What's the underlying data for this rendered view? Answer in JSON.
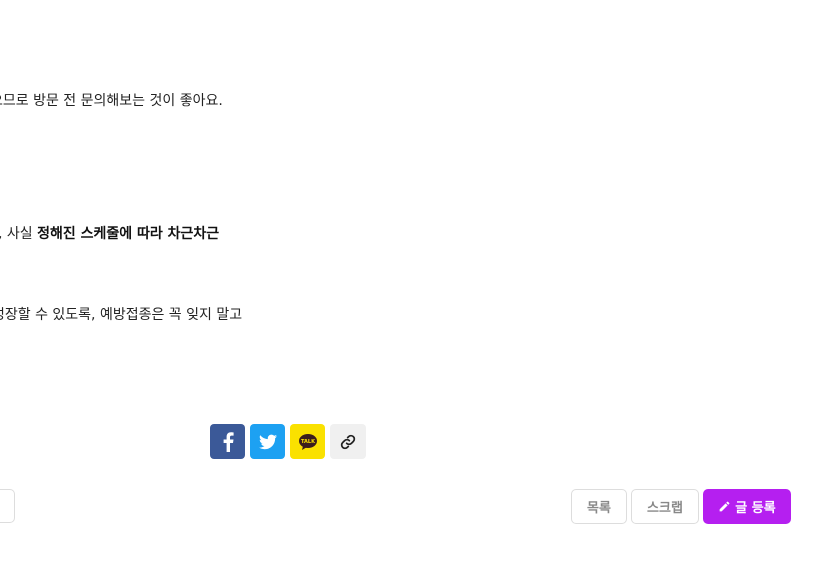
{
  "article": {
    "line1": "으므로 방문 전 문의해보는 것이 좋아요.",
    "line2_normal": ", 사실 ",
    "line2_bold": "정해진 스케줄에 따라 차근차근",
    "line3": "성장할 수 있도록, 예방접종은 꼭 잊지 말고"
  },
  "share": {
    "facebook_icon": "facebook-icon",
    "twitter_icon": "twitter-icon",
    "kakao_icon": "kakaotalk-icon",
    "kakao_label": "TALK",
    "link_icon": "link-icon",
    "colors": {
      "facebook": "#3b5998",
      "twitter": "#1da1f2",
      "kakao": "#fae100",
      "link_bg": "#f0f0f0"
    }
  },
  "actions": {
    "list_label": "목록",
    "scrap_label": "스크랩",
    "write_label": "글 등록",
    "write_icon": "pencil-icon",
    "accent_color": "#b51ff0"
  }
}
